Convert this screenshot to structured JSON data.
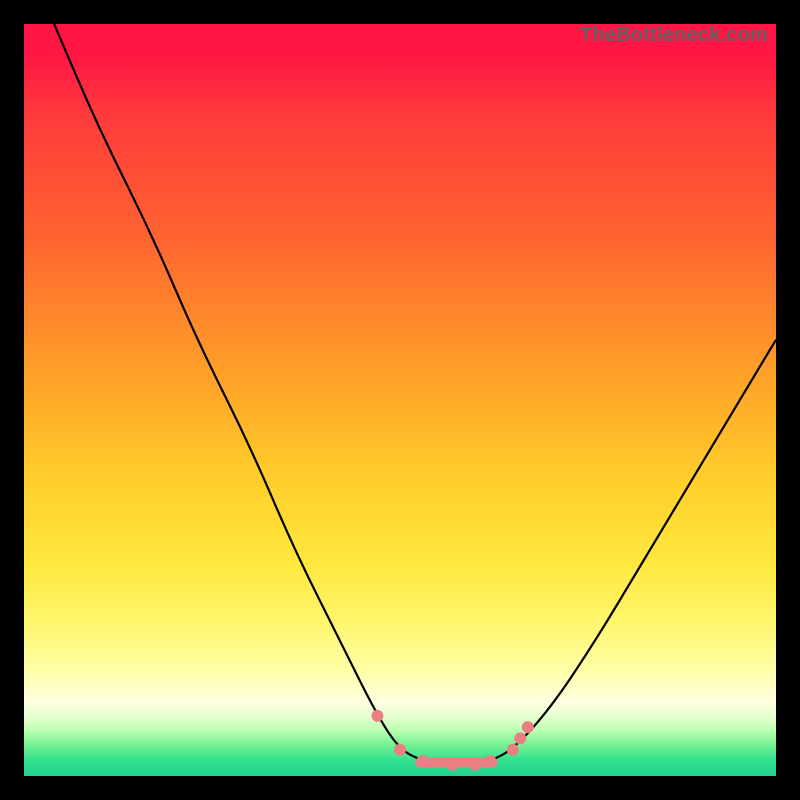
{
  "attribution": "TheBottleneck.com",
  "gradient": {
    "top": "#ff1644",
    "mid_upper": "#ffa528",
    "mid_lower": "#ffe840",
    "bottom": "#20d090"
  },
  "chart_data": {
    "type": "line",
    "title": "",
    "xlabel": "",
    "ylabel": "",
    "xlim": [
      0,
      100
    ],
    "ylim": [
      0,
      100
    ],
    "series": [
      {
        "name": "bottleneck-curve",
        "x": [
          4,
          10,
          17,
          23,
          30,
          36,
          42,
          47,
          50,
          53,
          56,
          60,
          62,
          65,
          70,
          76,
          82,
          88,
          94,
          100
        ],
        "y": [
          100,
          86,
          72,
          58,
          44,
          30,
          18,
          8,
          3.5,
          2,
          1.5,
          1.5,
          2,
          3.5,
          9,
          18,
          28,
          38,
          48,
          58
        ]
      }
    ],
    "markers": {
      "style": "pink-dots-with-bar",
      "color": "#e97f82",
      "points": [
        {
          "x": 47,
          "y": 8
        },
        {
          "x": 50,
          "y": 3.5
        },
        {
          "x": 53,
          "y": 2
        },
        {
          "x": 57,
          "y": 1.5
        },
        {
          "x": 60,
          "y": 1.5
        },
        {
          "x": 62,
          "y": 2
        },
        {
          "x": 65,
          "y": 3.5
        },
        {
          "x": 66,
          "y": 5
        },
        {
          "x": 67,
          "y": 6.5
        }
      ],
      "bar_span": {
        "x0": 52,
        "x1": 63,
        "y": 1.8
      }
    }
  }
}
